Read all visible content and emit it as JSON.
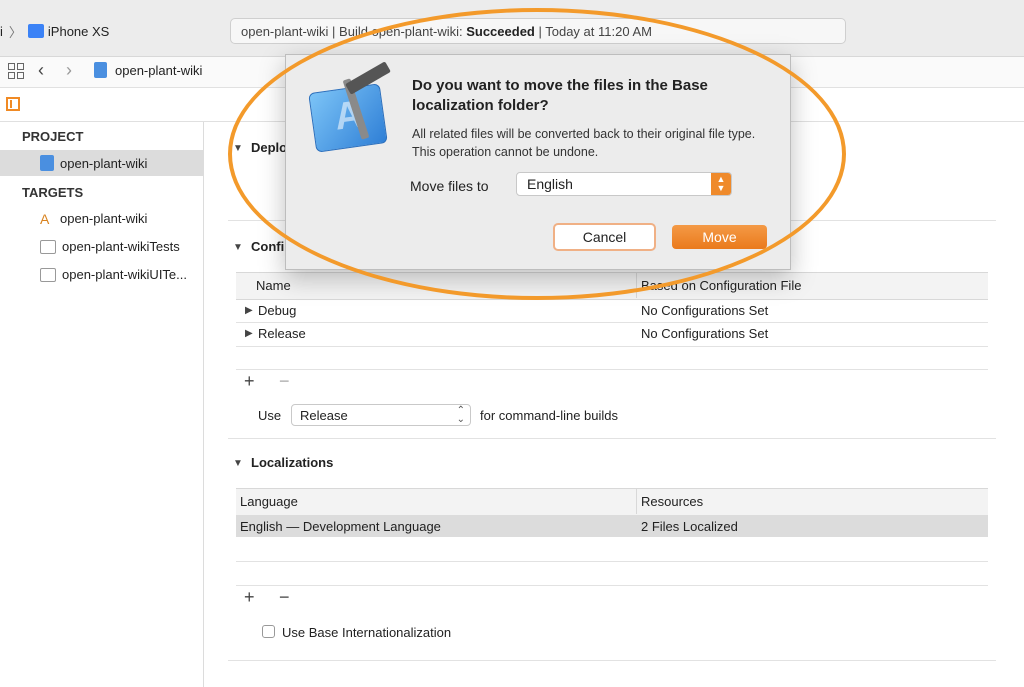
{
  "toolbar": {
    "scheme_prefix": "i",
    "device": "iPhone XS",
    "status_project": "open-plant-wiki",
    "status_sep1": " | Build ",
    "status_build_target": "open-plant-wiki: ",
    "status_result": "Succeeded",
    "status_time": " | Today at 11:20 AM"
  },
  "nav": {
    "title": "open-plant-wiki"
  },
  "sidebar": {
    "project_header": "PROJECT",
    "project_item": "open-plant-wiki",
    "targets_header": "TARGETS",
    "targets": [
      "open-plant-wiki",
      "open-plant-wikiTests",
      "open-plant-wikiUITe..."
    ]
  },
  "main": {
    "deployment_title": "Deplo",
    "configurations_title": "Confi",
    "config_table": {
      "headers": [
        "Name",
        "Based on Configuration File"
      ],
      "rows": [
        {
          "name": "Debug",
          "value": "No Configurations Set"
        },
        {
          "name": "Release",
          "value": "No Configurations Set"
        }
      ]
    },
    "plus": "+",
    "minus": "−",
    "use_label": "Use",
    "use_value": "Release",
    "use_suffix": "for command-line builds",
    "localizations_title": "Localizations",
    "loc_table": {
      "headers": [
        "Language",
        "Resources"
      ],
      "rows": [
        {
          "language": "English — Development Language",
          "resources": "2 Files Localized"
        }
      ]
    },
    "base_intl_label": "Use Base Internationalization"
  },
  "dialog": {
    "title": "Do you want to move the files in the Base localization folder?",
    "message": "All related files will be converted back to their original file type. This operation cannot be undone.",
    "move_files_label": "Move files to",
    "move_files_value": "English",
    "cancel_label": "Cancel",
    "move_label": "Move"
  },
  "colors": {
    "accent": "#ef8a2b",
    "highlight": "#f39a2b",
    "selection": "#dcdcdc"
  }
}
